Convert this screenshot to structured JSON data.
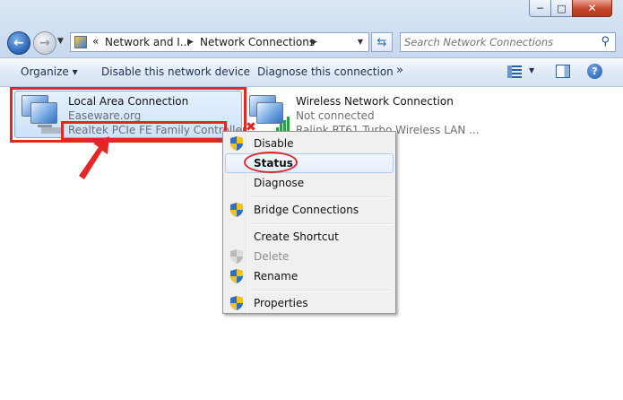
{
  "window": {
    "min_glyph": "─",
    "max_glyph": "□",
    "close_glyph": "✕"
  },
  "address_bar": {
    "breadcrumbs": [
      "Network and I...",
      "Network Connections"
    ],
    "overflow": "«"
  },
  "search": {
    "placeholder": "Search Network Connections"
  },
  "command_bar": {
    "organize": "Organize ▾",
    "disable_device": "Disable this network device",
    "diagnose": "Diagnose this connection",
    "more": "»"
  },
  "connections": [
    {
      "name": "Local Area Connection",
      "network": "Easeware.org",
      "adapter": "Realtek PCIe FE Family Controller",
      "selected": true
    },
    {
      "name": "Wireless Network Connection",
      "network": "Not connected",
      "adapter": "Ralink RT61 Turbo Wireless LAN ...",
      "selected": false
    }
  ],
  "context_menu": {
    "items": [
      {
        "label": "Disable",
        "shield": true,
        "disabled": false
      },
      {
        "label": "Status",
        "shield": false,
        "disabled": false,
        "hover": true
      },
      {
        "label": "Diagnose",
        "shield": false,
        "disabled": false
      },
      {
        "label": "Bridge Connections",
        "shield": true,
        "disabled": false
      },
      {
        "label": "Create Shortcut",
        "shield": false,
        "disabled": false
      },
      {
        "label": "Delete",
        "shield": true,
        "disabled": true
      },
      {
        "label": "Rename",
        "shield": true,
        "disabled": false
      },
      {
        "label": "Properties",
        "shield": true,
        "disabled": false
      }
    ]
  },
  "colors": {
    "annotation_red": "#e32727",
    "selection_blue": "#cde3fa",
    "signal_green": "#2ea043"
  },
  "icons": [
    "back-arrow-icon",
    "forward-arrow-icon",
    "network-folder-icon",
    "refresh-icon",
    "search-icon",
    "view-options-icon",
    "preview-pane-icon",
    "help-icon",
    "lan-adapter-icon",
    "wireless-adapter-icon",
    "uac-shield-icon"
  ]
}
